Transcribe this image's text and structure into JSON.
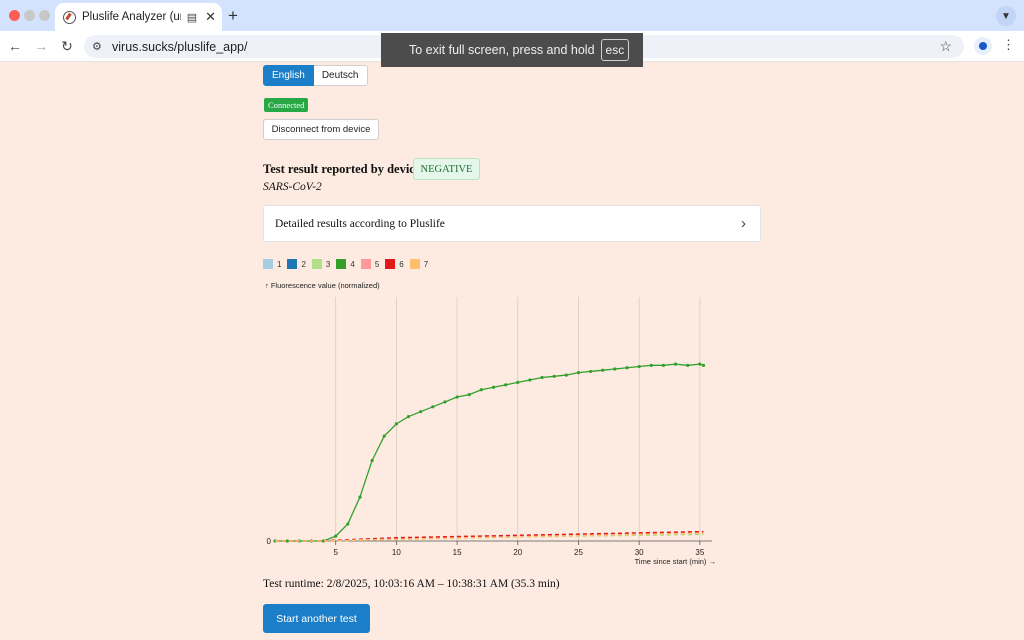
{
  "browser": {
    "tab_title": "Pluslife Analyzer (unofficial)",
    "new_tab_glyph": "+",
    "url": "virus.sucks/pluslife_app/",
    "fullscreen_toast": {
      "message": "To exit full screen, press and hold",
      "key": "esc"
    }
  },
  "language": {
    "options": [
      {
        "label": "English",
        "selected": true
      },
      {
        "label": "Deutsch",
        "selected": false
      }
    ]
  },
  "status": {
    "connected_label": "Connected",
    "connected_color": "#28a745"
  },
  "disconnect_label": "Disconnect from device",
  "result": {
    "label": "Test result reported by device:",
    "value": "NEGATIVE",
    "pathogen": "SARS-CoV-2"
  },
  "details": {
    "title": "Detailed results according to Pluslife"
  },
  "chart_data": {
    "type": "line",
    "xlabel": "Time since start (min) →",
    "ylabel": "↑ Fluorescence value (normalized)",
    "x_ticks": [
      5,
      10,
      15,
      20,
      25,
      30,
      35
    ],
    "y_ticks": [
      0
    ],
    "xlim": [
      0,
      36
    ],
    "ylim": [
      0,
      1
    ],
    "grid": "vertical",
    "legend_position": "top-left",
    "x": [
      0,
      1,
      2,
      3,
      4,
      5,
      6,
      7,
      8,
      9,
      10,
      11,
      12,
      13,
      14,
      15,
      16,
      17,
      18,
      19,
      20,
      21,
      22,
      23,
      24,
      25,
      26,
      27,
      28,
      29,
      30,
      31,
      32,
      33,
      34,
      35,
      35.3
    ],
    "series": [
      {
        "name": "1",
        "color": "#a6cee3",
        "values": [
          0,
          0,
          0,
          0,
          0,
          0.002,
          0.004,
          0.006,
          0.008,
          0.009,
          0.011,
          0.012,
          0.013,
          0.014,
          0.015,
          0.016,
          0.017,
          0.018,
          0.019,
          0.019,
          0.02,
          0.021,
          0.021,
          0.022,
          0.022,
          0.023,
          0.023,
          0.024,
          0.024,
          0.025,
          0.025,
          0.026,
          0.026,
          0.027,
          0.027,
          0.028,
          0.028
        ]
      },
      {
        "name": "2",
        "color": "#1f78b4",
        "values": [
          0,
          0,
          0,
          0,
          0,
          0.002,
          0.003,
          0.005,
          0.006,
          0.008,
          0.009,
          0.01,
          0.011,
          0.012,
          0.013,
          0.014,
          0.015,
          0.016,
          0.017,
          0.017,
          0.018,
          0.019,
          0.02,
          0.02,
          0.021,
          0.022,
          0.022,
          0.023,
          0.024,
          0.025,
          0.026,
          0.027,
          0.028,
          0.029,
          0.03,
          0.031,
          0.031
        ]
      },
      {
        "name": "3",
        "color": "#b2df8a",
        "values": [
          0,
          0,
          0,
          0,
          0,
          0.001,
          0.003,
          0.004,
          0.006,
          0.007,
          0.008,
          0.009,
          0.01,
          0.011,
          0.012,
          0.013,
          0.014,
          0.015,
          0.015,
          0.016,
          0.017,
          0.018,
          0.018,
          0.019,
          0.02,
          0.02,
          0.021,
          0.022,
          0.022,
          0.023,
          0.024,
          0.024,
          0.025,
          0.026,
          0.026,
          0.027,
          0.027
        ]
      },
      {
        "name": "4",
        "color": "#33a02c",
        "values": [
          0,
          0,
          0,
          0,
          0,
          0.02,
          0.07,
          0.18,
          0.33,
          0.43,
          0.48,
          0.51,
          0.53,
          0.55,
          0.57,
          0.59,
          0.6,
          0.62,
          0.63,
          0.64,
          0.65,
          0.66,
          0.67,
          0.675,
          0.68,
          0.69,
          0.695,
          0.7,
          0.705,
          0.71,
          0.715,
          0.72,
          0.72,
          0.725,
          0.72,
          0.725,
          0.72
        ]
      },
      {
        "name": "5",
        "color": "#fb9a99",
        "values": [
          0,
          0,
          0,
          0,
          0,
          0.002,
          0.004,
          0.006,
          0.008,
          0.01,
          0.012,
          0.013,
          0.014,
          0.015,
          0.016,
          0.017,
          0.018,
          0.019,
          0.02,
          0.021,
          0.022,
          0.023,
          0.024,
          0.025,
          0.026,
          0.027,
          0.028,
          0.029,
          0.03,
          0.031,
          0.032,
          0.033,
          0.034,
          0.035,
          0.036,
          0.037,
          0.037
        ]
      },
      {
        "name": "6",
        "color": "#e31a1c",
        "values": [
          0,
          0,
          0,
          0,
          0,
          0.003,
          0.005,
          0.007,
          0.009,
          0.011,
          0.013,
          0.014,
          0.015,
          0.016,
          0.017,
          0.018,
          0.019,
          0.02,
          0.021,
          0.022,
          0.023,
          0.024,
          0.025,
          0.026,
          0.027,
          0.028,
          0.029,
          0.03,
          0.031,
          0.032,
          0.033,
          0.034,
          0.035,
          0.036,
          0.037,
          0.038,
          0.038
        ]
      },
      {
        "name": "7",
        "color": "#fdbf6f",
        "values": [
          0,
          0,
          0,
          0,
          0,
          0.001,
          0.002,
          0.004,
          0.005,
          0.006,
          0.007,
          0.008,
          0.009,
          0.01,
          0.011,
          0.012,
          0.013,
          0.014,
          0.015,
          0.016,
          0.017,
          0.018,
          0.019,
          0.02,
          0.021,
          0.022,
          0.023,
          0.024,
          0.025,
          0.026,
          0.027,
          0.028,
          0.029,
          0.03,
          0.031,
          0.032,
          0.032
        ]
      }
    ]
  },
  "runtime": "Test runtime: 2/8/2025, 10:03:16 AM – 10:38:31 AM (35.3 min)",
  "start_label": "Start another test",
  "colors": {
    "accent": "#1a7ec9",
    "page_background": "#fdebe1"
  }
}
